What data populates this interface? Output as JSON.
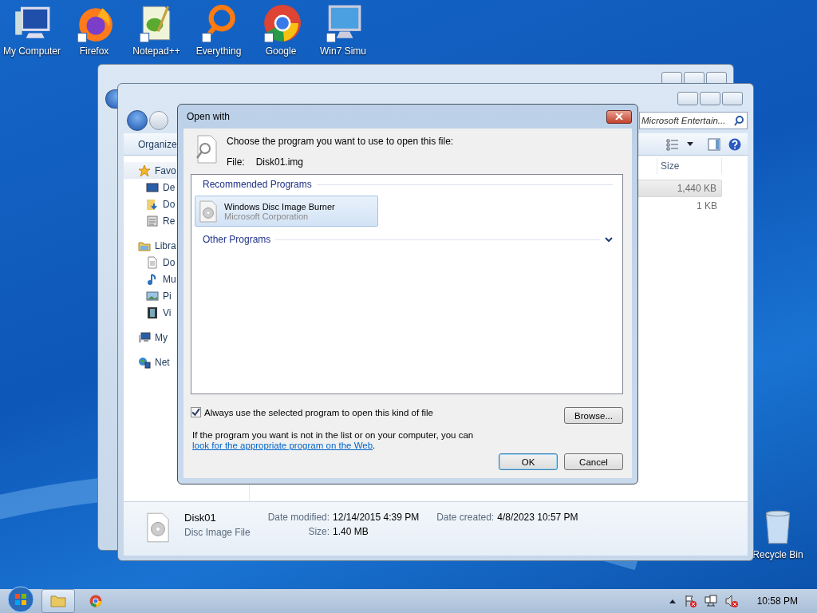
{
  "desktop_icons": [
    {
      "label": "My Computer",
      "kind": "computer"
    },
    {
      "label": "Firefox",
      "kind": "fox"
    },
    {
      "label": "Notepad++",
      "kind": "notepad"
    },
    {
      "label": "Everything",
      "kind": "ring"
    },
    {
      "label": "Google",
      "kind": "chrome"
    },
    {
      "label": "Win7 Simu",
      "kind": "monitor"
    }
  ],
  "recycle_bin": {
    "label": "Recycle Bin"
  },
  "explorer": {
    "search": {
      "placeholder": "Microsoft Entertain..."
    },
    "organize": "Organize",
    "nav": [
      {
        "label": "Favo",
        "kind": "star",
        "children": [
          {
            "label": "De",
            "kind": "desktop"
          },
          {
            "label": "Do",
            "kind": "downloads"
          },
          {
            "label": "Re",
            "kind": "recent"
          }
        ]
      },
      {
        "label": "Libra",
        "kind": "library",
        "children": [
          {
            "label": "Do",
            "kind": "document"
          },
          {
            "label": "Mu",
            "kind": "music"
          },
          {
            "label": "Pi",
            "kind": "picture"
          },
          {
            "label": "Vi",
            "kind": "video"
          }
        ]
      },
      {
        "label": "My",
        "kind": "computer"
      },
      {
        "label": "Net",
        "kind": "network"
      }
    ],
    "size_column": "Size",
    "rows": [
      {
        "size": "1,440 KB",
        "selected": true
      },
      {
        "size": "1 KB",
        "selected": false
      }
    ],
    "details": {
      "name": "Disk01",
      "type": "Disc Image File",
      "date_modified_label": "Date modified:",
      "date_modified": "12/14/2015 4:39 PM",
      "size_label": "Size:",
      "size": "1.40 MB",
      "date_created_label": "Date created:",
      "date_created": "4/8/2023 10:57 PM"
    }
  },
  "dialog": {
    "title": "Open with",
    "prompt": "Choose the program you want to use to open this file:",
    "file_label": "File:",
    "file_name": "Disk01.img",
    "groups": [
      {
        "title": "Recommended Programs",
        "expanded": true,
        "programs": [
          {
            "name": "Windows Disc Image Burner",
            "publisher": "Microsoft Corporation",
            "selected": true
          }
        ]
      },
      {
        "title": "Other Programs",
        "expanded": false
      }
    ],
    "always_use": {
      "label": "Always use the selected program to open this kind of file",
      "checked": true
    },
    "browse": "Browse...",
    "info": "If the program you want is not in the list or on your computer, you can ",
    "info_link": "look for the appropriate program on the Web",
    "info_end": ".",
    "ok": "OK",
    "cancel": "Cancel"
  },
  "taskbar": {
    "buttons": [
      {
        "kind": "folder"
      },
      {
        "kind": "chrome"
      }
    ],
    "clock": "10:58 PM"
  }
}
